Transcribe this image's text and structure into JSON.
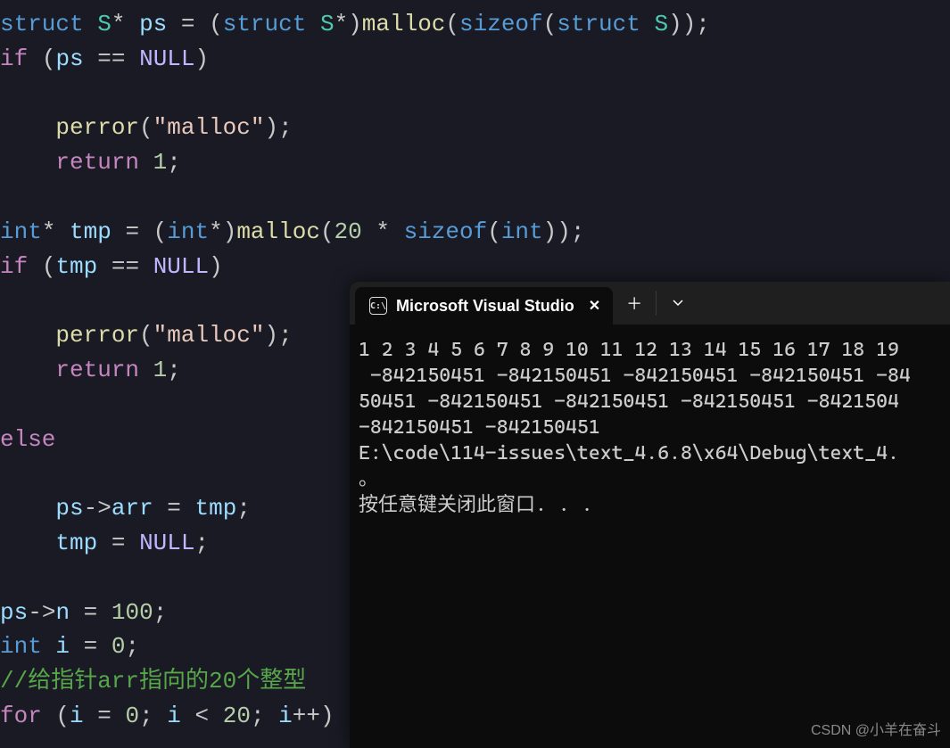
{
  "code": {
    "l1": {
      "t1": "struct",
      "t2": "S",
      "t3": "ps",
      "t4": "struct",
      "t5": "S",
      "t6": "malloc",
      "t7": "sizeof",
      "t8": "struct",
      "t9": "S"
    },
    "l2": {
      "t1": "if",
      "t2": "ps",
      "t3": "NULL"
    },
    "l4": {
      "t1": "perror",
      "t2": "\"malloc\""
    },
    "l5": {
      "t1": "return",
      "t2": "1"
    },
    "l7": {
      "t1": "int",
      "t2": "tmp",
      "t3": "int",
      "t4": "malloc",
      "t5": "20",
      "t6": "sizeof",
      "t7": "int"
    },
    "l8": {
      "t1": "if",
      "t2": "tmp",
      "t3": "NULL"
    },
    "l10": {
      "t1": "perror",
      "t2": "\"malloc\""
    },
    "l11": {
      "t1": "return",
      "t2": "1"
    },
    "l13": {
      "t1": "else"
    },
    "l15": {
      "t1": "ps",
      "t2": "arr",
      "t3": "tmp"
    },
    "l16": {
      "t1": "tmp",
      "t2": "NULL"
    },
    "l18": {
      "t1": "ps",
      "t2": "n",
      "t3": "100"
    },
    "l19": {
      "t1": "int",
      "t2": "i",
      "t3": "0"
    },
    "l20": {
      "t1": "//给指针arr指向的20个整型"
    },
    "l21": {
      "t1": "for",
      "t2": "i",
      "t3": "0",
      "t4": "i",
      "t5": "20",
      "t6": "i"
    }
  },
  "terminal": {
    "tab_title": "Microsoft Visual Studio",
    "icon_text": "C:\\",
    "output": "1 2 3 4 5 6 7 8 9 10 11 12 13 14 15 16 17 18 19\n -842150451 -842150451 -842150451 -842150451 -84\n50451 -842150451 -842150451 -842150451 -8421504\n-842150451 -842150451\nE:\\code\\114-issues\\text_4.6.8\\x64\\Debug\\text_4.\n。\n按任意键关闭此窗口. . ."
  },
  "watermark": "CSDN @小羊在奋斗"
}
